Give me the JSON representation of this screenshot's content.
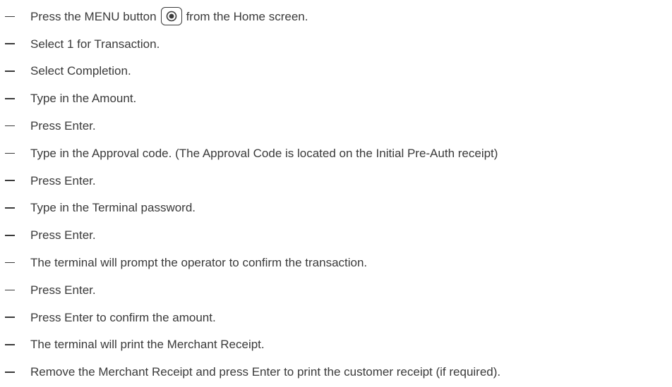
{
  "steps": [
    {
      "before": "Press the MENU button",
      "icon": "menu-button-icon",
      "after": "from the Home screen."
    },
    {
      "text": "Select 1 for Transaction."
    },
    {
      "text": "Select Completion."
    },
    {
      "text": "Type in the Amount."
    },
    {
      "text": "Press Enter."
    },
    {
      "text": "Type in the Approval code. (The Approval Code is located on the Initial Pre-Auth receipt)"
    },
    {
      "text": "Press Enter."
    },
    {
      "text": "Type in the Terminal password."
    },
    {
      "text": "Press Enter."
    },
    {
      "text": "The terminal will prompt the operator to confirm the transaction."
    },
    {
      "text": "Press Enter."
    },
    {
      "text": "Press Enter to confirm the amount."
    },
    {
      "text": "The terminal will print the Merchant Receipt."
    },
    {
      "text": "Remove the Merchant Receipt and press Enter to print the customer receipt (if required)."
    }
  ]
}
